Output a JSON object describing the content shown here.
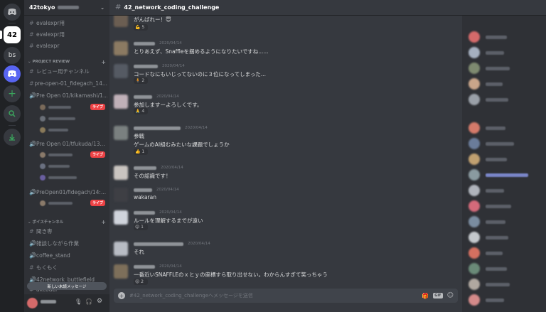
{
  "servers": {
    "items": [
      {
        "name": "discord-home",
        "label": ""
      },
      {
        "name": "42tokyo",
        "label": "42"
      },
      {
        "name": "bs",
        "label": "bs"
      },
      {
        "name": "discord",
        "label": ""
      },
      {
        "name": "add",
        "label": "+"
      },
      {
        "name": "explore",
        "label": ""
      },
      {
        "name": "download",
        "label": ""
      }
    ]
  },
  "guild": {
    "name": "42tokyo"
  },
  "channels": {
    "top_items": [
      "evalexpr用",
      "evalexpr用",
      "evalexpr"
    ],
    "project_review_label": "PROJECT REVIEW",
    "project_review_items": [
      "レビュー用チャンネル",
      "pre-open-01_fidegach_14...",
      "Pre Open 01/kikamashi/1...",
      "Pre Open 01/tfukuda/13...",
      "PreOpen01/fidegach/14:..."
    ],
    "live_label": "ライブ",
    "voice_label": "ボイスチャンネル",
    "voice_items": [
      "聞き専",
      "雑談しながら作業",
      "coffee_stand",
      "もくもく",
      "42network_buttlefield",
      "akcoder"
    ],
    "new_messages": "新しい未読メッセージ"
  },
  "chat": {
    "channel_name": "42_network_coding_challenge",
    "composer_placeholder": "#42_network_coding_challengeへメッセージを送信",
    "messages": [
      {
        "time": "",
        "text": "がんばれー！😇",
        "reaction": "💪 5"
      },
      {
        "time": "2020/04/14",
        "text": "とりあえず、Snaffleを掴めるようになりたいですね......",
        "reaction": ""
      },
      {
        "time": "2020/04/14",
        "text": "コードなにもいじってないのに３位になってしまった...",
        "reaction": "🧍 2"
      },
      {
        "time": "2020/04/14",
        "text": "参加しますーよろしくです。",
        "reaction": "🙏 4"
      },
      {
        "time": "2020/04/14",
        "text": "参戦",
        "text2": "ゲームのAI組むみたいな課題でしょうか",
        "reaction": "👍 1"
      },
      {
        "time": "2020/04/14",
        "text": "その認識です！",
        "reaction": ""
      },
      {
        "time": "2020/04/14",
        "text": "wakaran",
        "reaction": ""
      },
      {
        "time": "2020/04/14",
        "text": "ルールを理解するまでが遠い",
        "reaction": "😝 1"
      },
      {
        "time": "2020/04/14",
        "text": "それ",
        "reaction": ""
      },
      {
        "time": "2020/04/14",
        "text": "一番近いSNAFFLEのｘとｙの座標すら取り出せない。わからんすぎて笑っちゃう",
        "reaction": "😝 2"
      }
    ]
  },
  "header": {
    "search_placeholder": "検索"
  },
  "colors": {
    "accent": "#5865f2",
    "live": "#ed4245",
    "background": "#36393f",
    "sidebar": "#2f3136",
    "rail": "#202225"
  },
  "icons": [
    "bell-icon",
    "pin-icon",
    "members-icon",
    "search-icon",
    "mention-icon",
    "help-icon",
    "mic-icon",
    "headphones-icon",
    "gear-icon",
    "gift-icon",
    "gif-icon",
    "emoji-icon",
    "add-icon"
  ]
}
